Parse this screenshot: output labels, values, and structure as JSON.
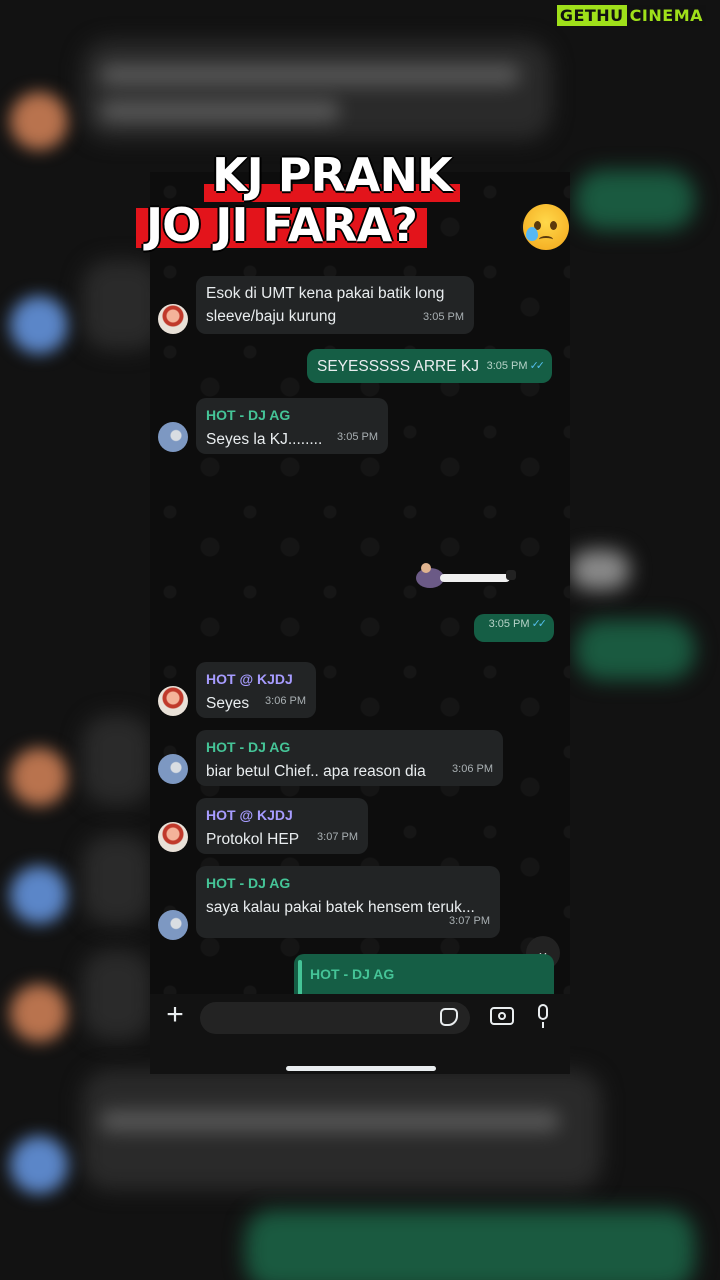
{
  "watermark": {
    "part1": "GETHU",
    "part2": "CINEMA"
  },
  "title": {
    "line1": "KJ PRANK",
    "line2": "JO JI FARA?"
  },
  "chat": {
    "messages": [
      {
        "type": "in",
        "sender": "",
        "text": "Esok di UMT kena pakai batik long sleeve/baju kurung",
        "time": "3:05 PM"
      },
      {
        "type": "out",
        "text": "SEYESSSSS ARRE KJ",
        "time": "3:05 PM"
      },
      {
        "type": "in",
        "sender": "HOT - DJ AG",
        "text": "Seyes la KJ........",
        "time": "3:05 PM"
      },
      {
        "type": "out",
        "text": "",
        "time": "3:05 PM"
      },
      {
        "type": "in",
        "sender": "HOT @ KJDJ",
        "text": "Seyes",
        "time": "3:06 PM"
      },
      {
        "type": "in",
        "sender": "HOT - DJ AG",
        "text": "biar betul Chief.. apa reason dia",
        "time": "3:06 PM"
      },
      {
        "type": "in",
        "sender": "HOT @ KJDJ",
        "text": "Protokol HEP",
        "time": "3:07 PM"
      },
      {
        "type": "in",
        "sender": "HOT - DJ AG",
        "text": "saya kalau pakai batek hensem teruk...",
        "time": "3:07 PM"
      }
    ],
    "quoted_sender": "HOT - DJ AG",
    "read_ticks": "✓✓"
  },
  "icons": {
    "plus": "plus-icon",
    "sticker": "sticker-icon",
    "camera": "camera-icon",
    "mic": "microphone-icon",
    "scroll": "chevron-down-icon"
  }
}
